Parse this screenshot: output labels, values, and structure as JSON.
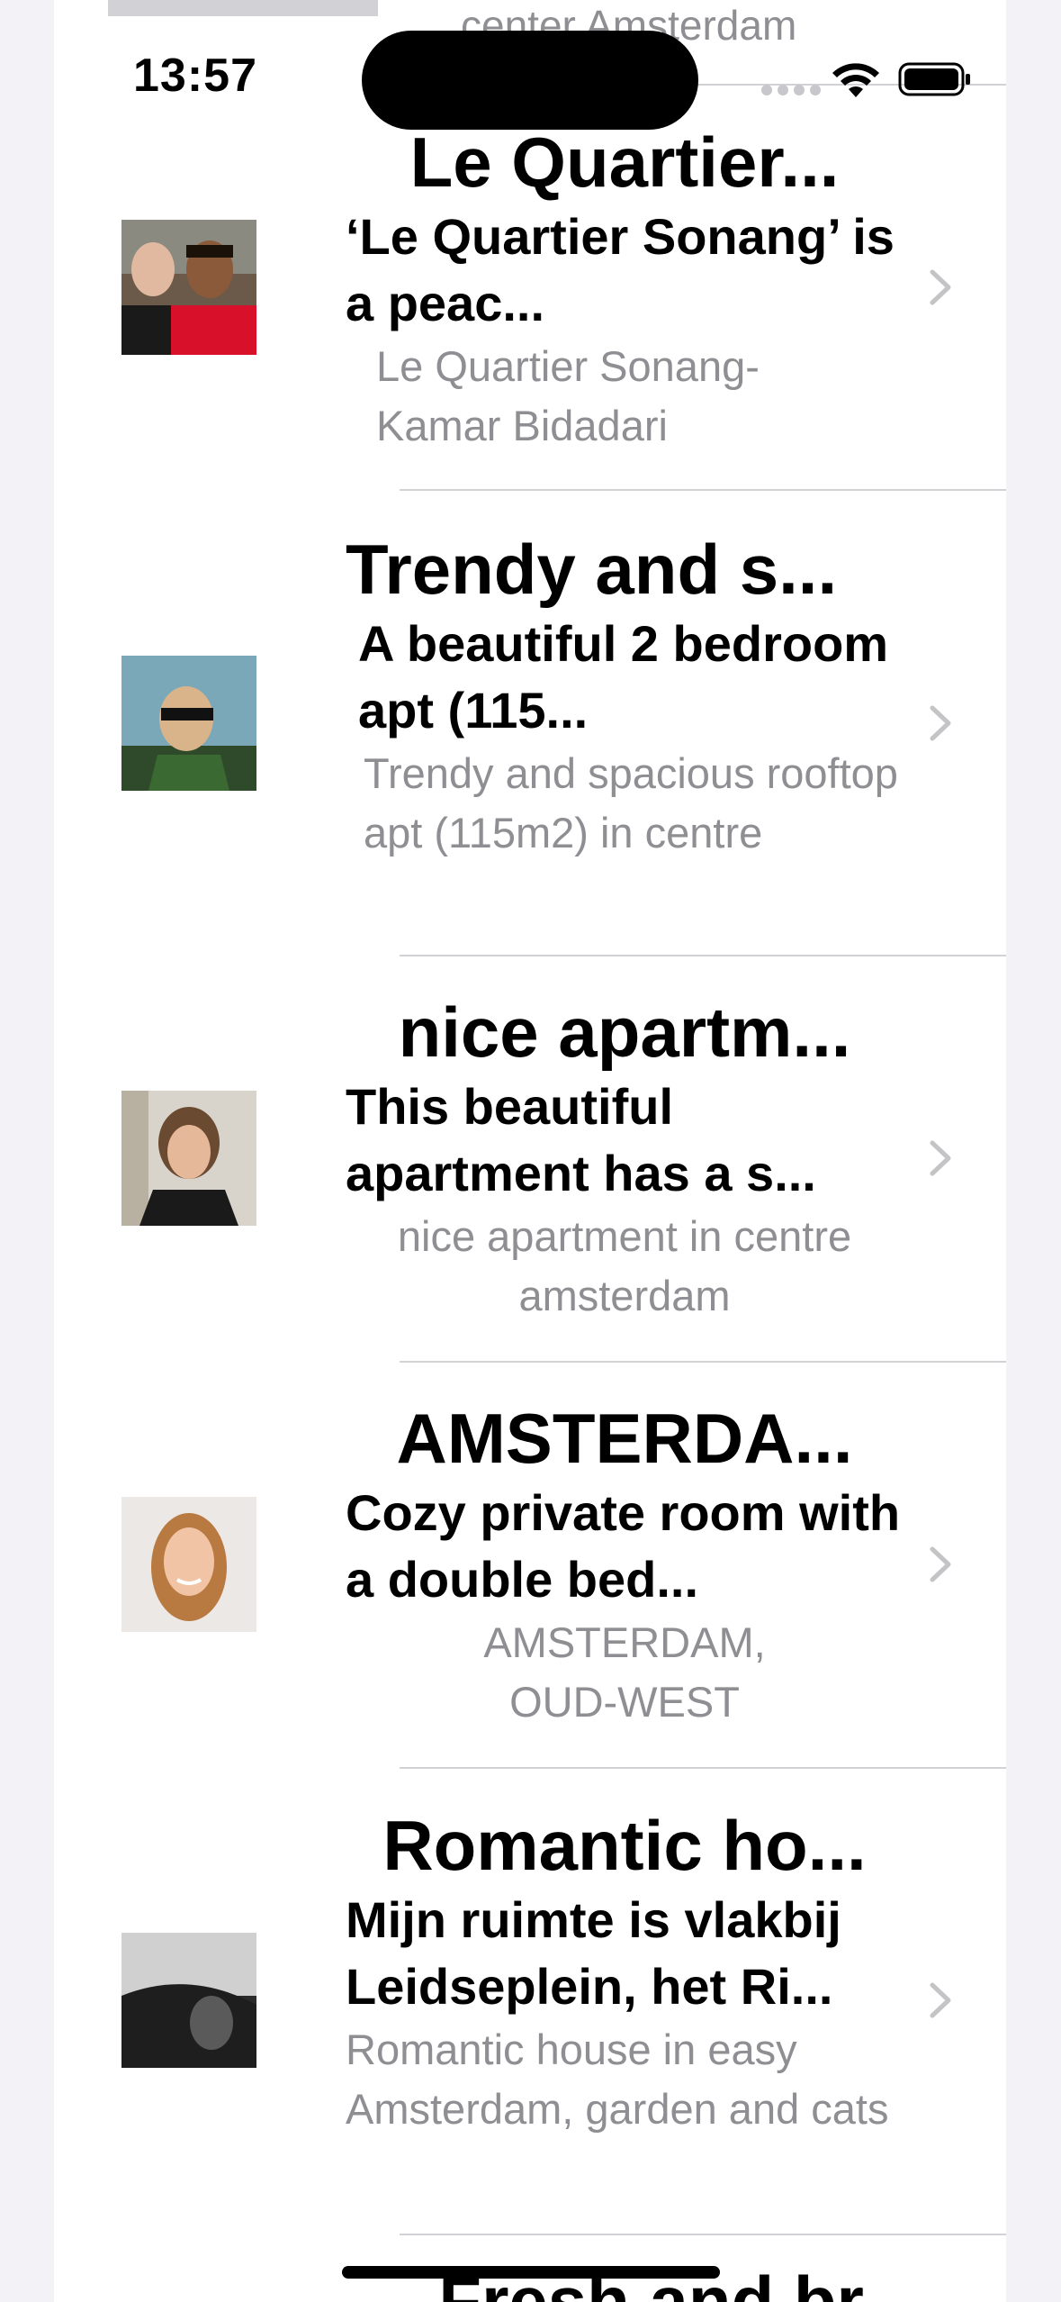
{
  "status_bar": {
    "time": "13:57"
  },
  "previous_row": {
    "subtitle": "center Amsterdam"
  },
  "listings": [
    {
      "title": "Le Quartier...",
      "description": "‘Le Quartier Sonang’ is a peac...",
      "subtitle": "Le Quartier Sonang-Kamar Bidadari",
      "avatar": "two-men-photo"
    },
    {
      "title": "Trendy and s...",
      "description": "A beautiful 2 bedroom apt (115...",
      "subtitle": "Trendy and spacious rooftop apt (115m2) in centre",
      "avatar": "man-sunglasses-photo"
    },
    {
      "title": "nice apartm...",
      "description": "This beautiful apartment has a s...",
      "subtitle": "nice apartment in centre amsterdam",
      "avatar": "woman-photo"
    },
    {
      "title": "AMSTERDA...",
      "description": "Cozy private room with a double bed...",
      "subtitle": "AMSTERDAM, OUD-WEST",
      "avatar": "young-woman-photo"
    },
    {
      "title": "Romantic ho...",
      "description": "Mijn ruimte is vlakbij Leidseplein, het Ri...",
      "subtitle": "Romantic house in easy Amsterdam, garden and cats",
      "avatar": "black-white-photo"
    }
  ],
  "next_row": {
    "title": "Fresh and br..."
  },
  "colors": {
    "background": "#f2f2f7",
    "card": "#ffffff",
    "secondary_text": "#8e8e93",
    "separator": "#d1d1d6"
  }
}
